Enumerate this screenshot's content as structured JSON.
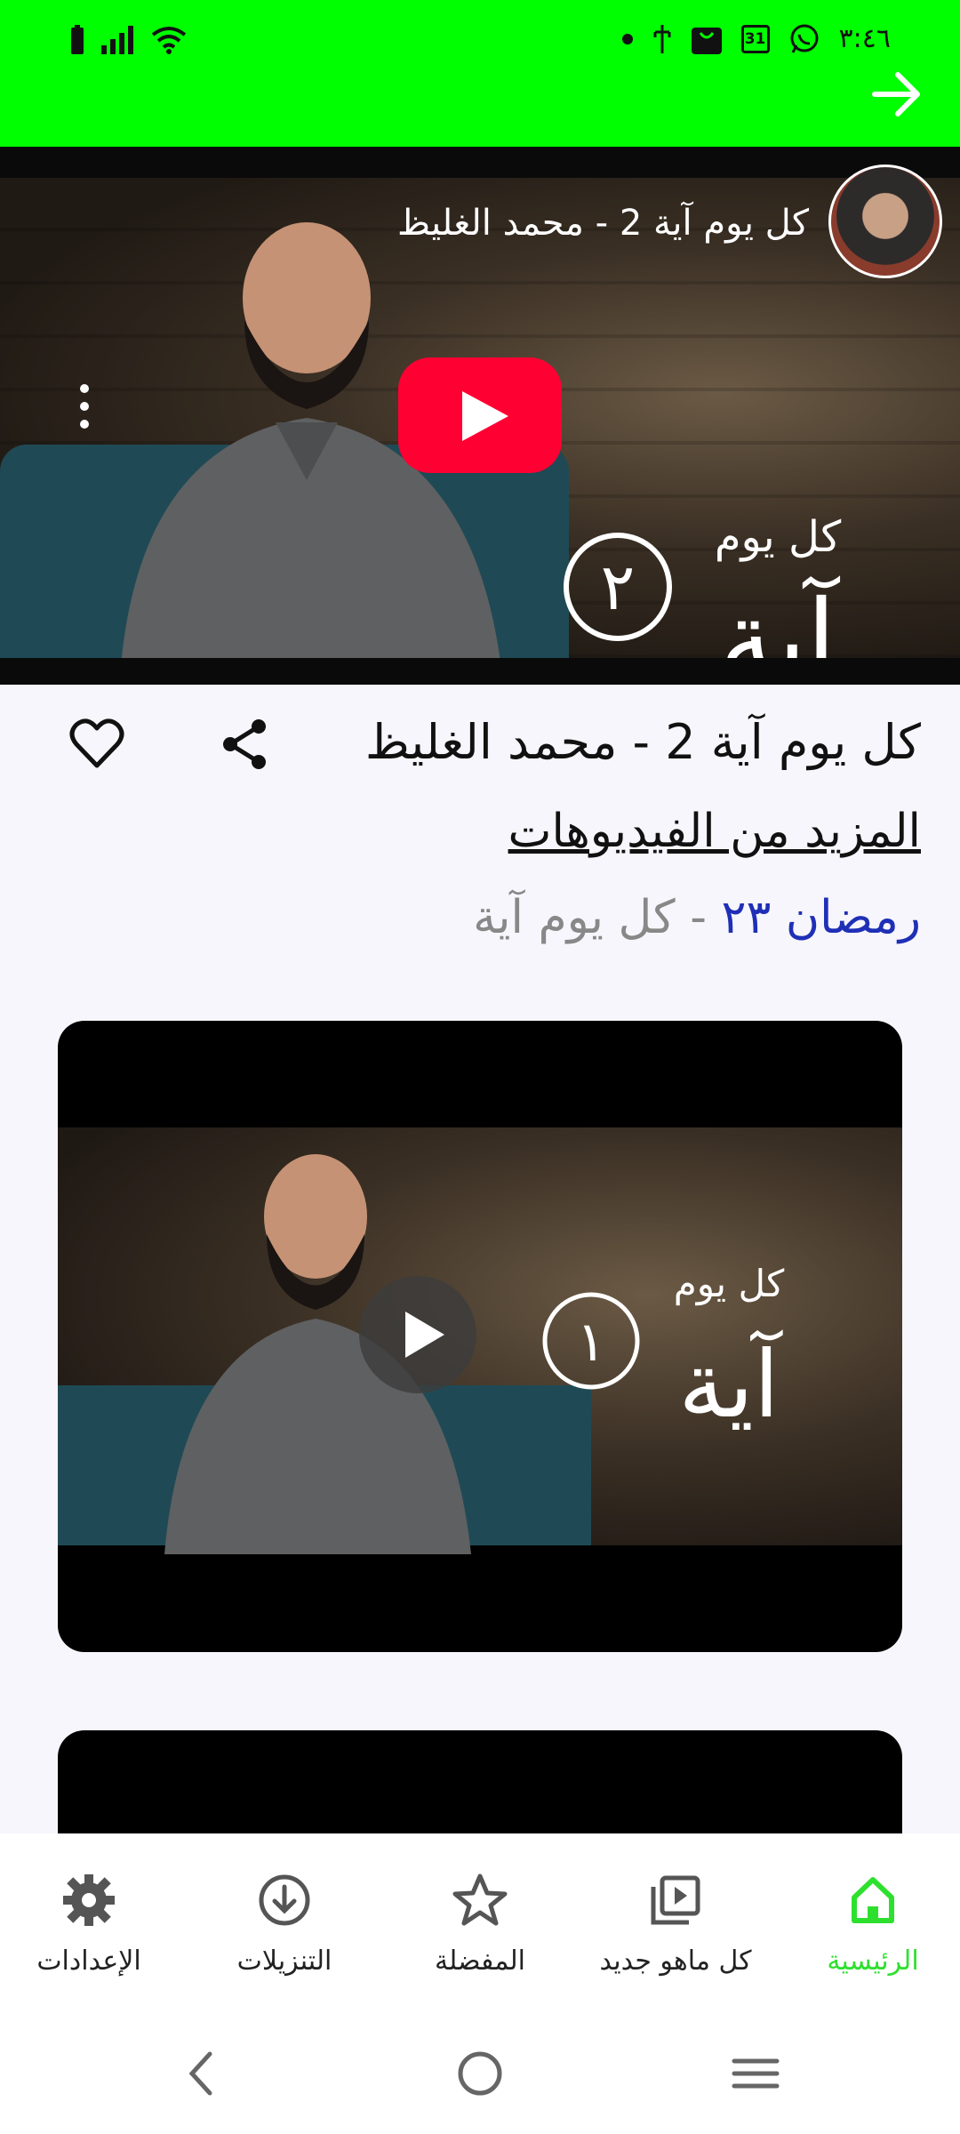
{
  "status_bar": {
    "time": "٣:٤٦",
    "icons_right": [
      "dot-icon",
      "usb-icon",
      "shopping-bag-icon",
      "calendar-icon",
      "whatsapp-icon"
    ],
    "icons_left": [
      "battery-icon",
      "signal-icon",
      "wifi-icon"
    ],
    "calendar_day": "31"
  },
  "header": {
    "back_icon": "arrow-right-icon"
  },
  "hero_video": {
    "title": "كل يوم آية 2 - محمد الغليظ",
    "logo_text": "كل يوم آية",
    "episode_numeral": "٢"
  },
  "video_info": {
    "title": "كل يوم آية 2 - محمد الغليظ",
    "more_videos_label": "المزيد من الفيديوهات",
    "category_primary": "رمضان ٢٣",
    "category_separator": " - ",
    "category_secondary": "كل يوم آية"
  },
  "video_cards": [
    {
      "logo_text": "كل يوم آية",
      "episode_numeral": "١"
    }
  ],
  "bottom_nav": {
    "items": [
      {
        "label": "الرئيسية",
        "icon": "home-icon",
        "active": true
      },
      {
        "label": "كل ماهو جديد",
        "icon": "video-library-icon",
        "active": false
      },
      {
        "label": "المفضلة",
        "icon": "star-icon",
        "active": false
      },
      {
        "label": "التنزيلات",
        "icon": "download-icon",
        "active": false
      },
      {
        "label": "الإعدادات",
        "icon": "settings-icon",
        "active": false
      }
    ]
  },
  "colors": {
    "accent": "#00ff00",
    "active_nav": "#2ee02e",
    "link_blue": "#1f2fb6",
    "youtube_red": "#ff0033"
  }
}
